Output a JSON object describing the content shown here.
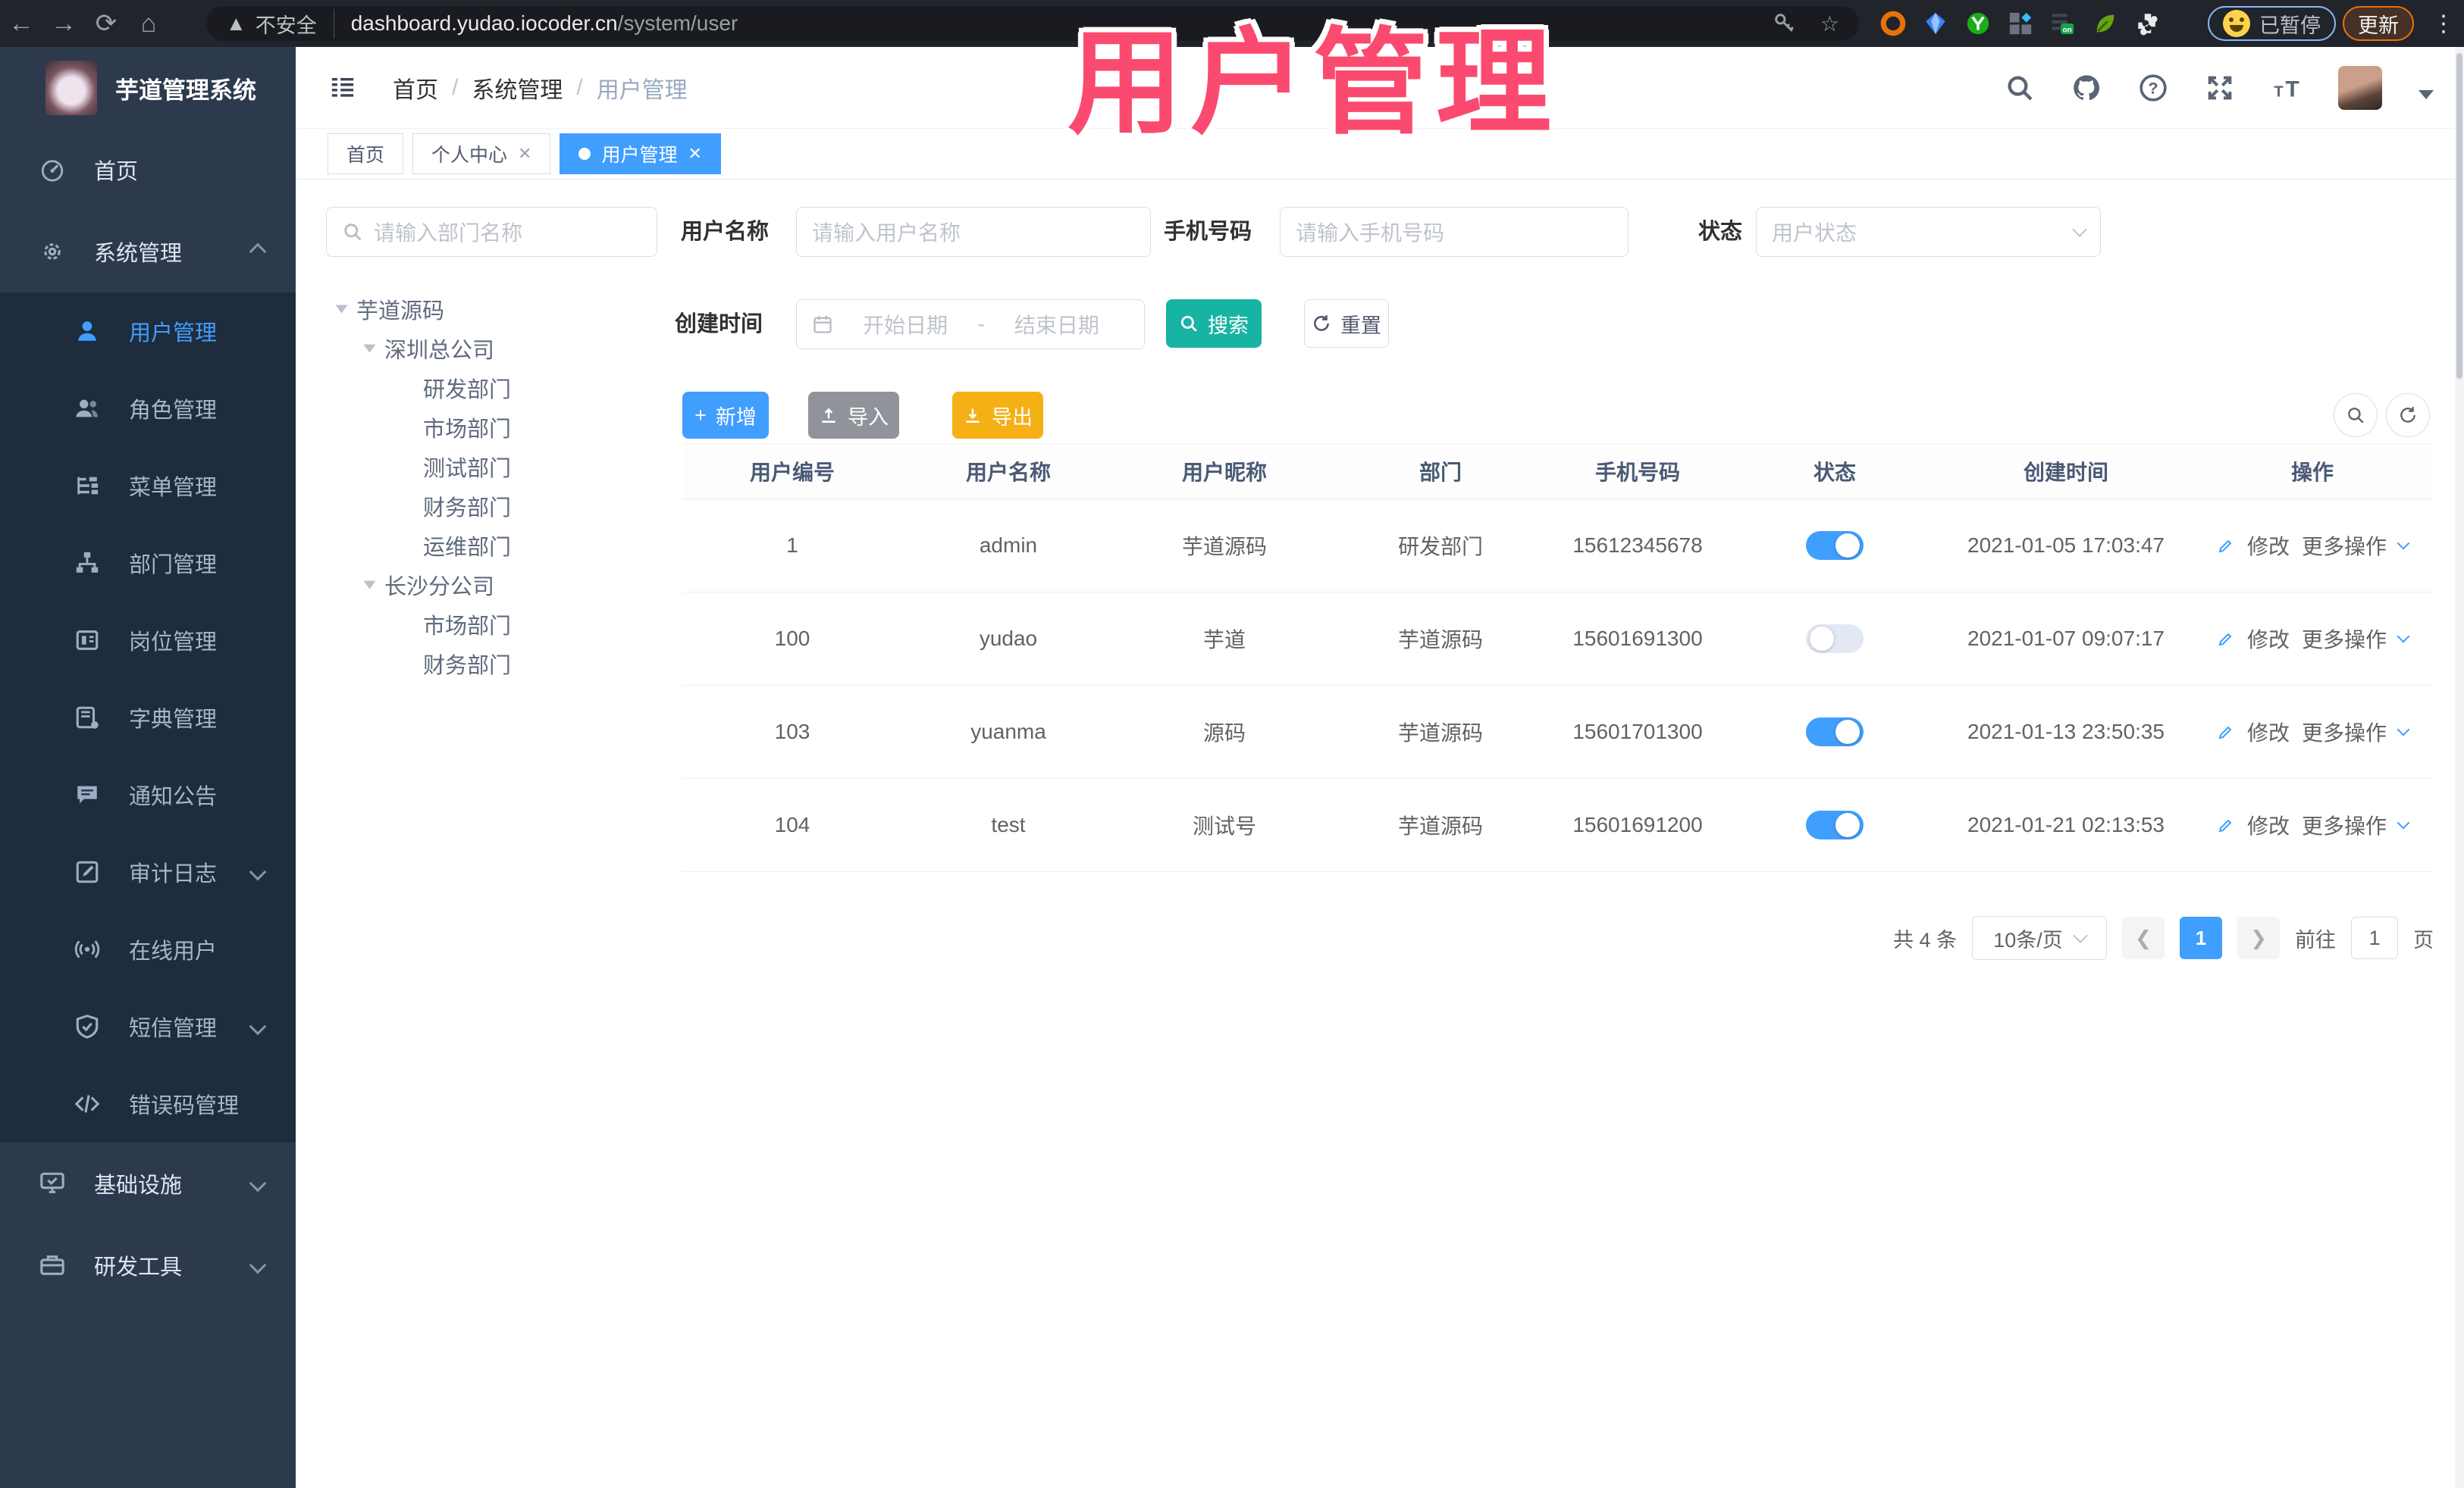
{
  "browser": {
    "security_label": "不安全",
    "url_host": "dashboard.yudao.iocoder.cn",
    "url_path": "/system/user",
    "paused_label": "已暂停",
    "update_label": "更新"
  },
  "overlay": {
    "title": "用户管理"
  },
  "app": {
    "title": "芋道管理系统"
  },
  "breadcrumb": {
    "separator": "/",
    "items": [
      "首页",
      "系统管理",
      "用户管理"
    ]
  },
  "tabs": [
    {
      "label": "首页"
    },
    {
      "label": "个人中心"
    },
    {
      "label": "用户管理"
    }
  ],
  "sidebar": {
    "items": [
      {
        "label": "首页"
      },
      {
        "label": "系统管理"
      },
      {
        "label": "用户管理"
      },
      {
        "label": "角色管理"
      },
      {
        "label": "菜单管理"
      },
      {
        "label": "部门管理"
      },
      {
        "label": "岗位管理"
      },
      {
        "label": "字典管理"
      },
      {
        "label": "通知公告"
      },
      {
        "label": "审计日志"
      },
      {
        "label": "在线用户"
      },
      {
        "label": "短信管理"
      },
      {
        "label": "错误码管理"
      },
      {
        "label": "基础设施"
      },
      {
        "label": "研发工具"
      }
    ]
  },
  "dept": {
    "search_placeholder": "请输入部门名称",
    "tree": [
      {
        "label": "芋道源码"
      },
      {
        "label": "深圳总公司"
      },
      {
        "label": "研发部门"
      },
      {
        "label": "市场部门"
      },
      {
        "label": "测试部门"
      },
      {
        "label": "财务部门"
      },
      {
        "label": "运维部门"
      },
      {
        "label": "长沙分公司"
      },
      {
        "label": "市场部门"
      },
      {
        "label": "财务部门"
      }
    ]
  },
  "filters": {
    "username_label": "用户名称",
    "username_placeholder": "请输入用户名称",
    "mobile_label": "手机号码",
    "mobile_placeholder": "请输入手机号码",
    "status_label": "状态",
    "status_placeholder": "用户状态",
    "created_label": "创建时间",
    "start_placeholder": "开始日期",
    "range_separator": "-",
    "end_placeholder": "结束日期",
    "search_label": "搜索",
    "reset_label": "重置"
  },
  "toolbar": {
    "add_label": "新增",
    "import_label": "导入",
    "export_label": "导出"
  },
  "table": {
    "columns": [
      "用户编号",
      "用户名称",
      "用户昵称",
      "部门",
      "手机号码",
      "状态",
      "创建时间",
      "操作"
    ],
    "edit_label": "修改",
    "more_label": "更多操作",
    "rows": [
      {
        "id": "1",
        "username": "admin",
        "nickname": "芋道源码",
        "dept": "研发部门",
        "mobile": "15612345678",
        "status_on": true,
        "created": "2021-01-05 17:03:47"
      },
      {
        "id": "100",
        "username": "yudao",
        "nickname": "芋道",
        "dept": "芋道源码",
        "mobile": "15601691300",
        "status_on": false,
        "created": "2021-01-07 09:07:17"
      },
      {
        "id": "103",
        "username": "yuanma",
        "nickname": "源码",
        "dept": "芋道源码",
        "mobile": "15601701300",
        "status_on": true,
        "created": "2021-01-13 23:50:35"
      },
      {
        "id": "104",
        "username": "test",
        "nickname": "测试号",
        "dept": "芋道源码",
        "mobile": "15601691200",
        "status_on": true,
        "created": "2021-01-21 02:13:53"
      }
    ]
  },
  "pagination": {
    "total": "共 4 条",
    "page_size": "10条/页",
    "current": "1",
    "goto_label": "前往",
    "goto_value": "1",
    "page_label": "页"
  }
}
